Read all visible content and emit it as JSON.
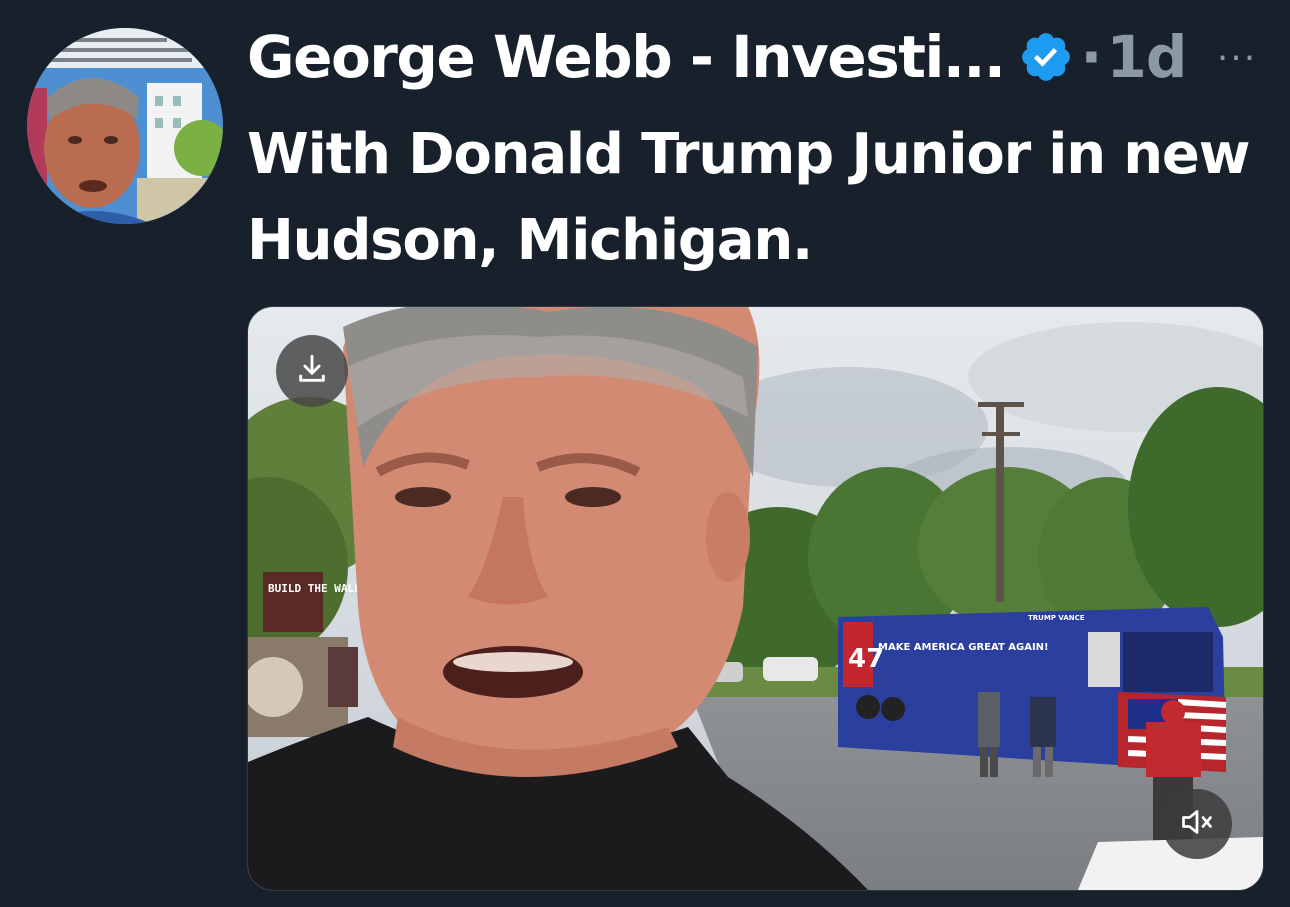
{
  "tweet": {
    "author_name": "George Webb - Investi...",
    "separator": "·",
    "timestamp": "1d",
    "more_label": "···",
    "text": "With Donald Trump Junior in new Hudson, Michigan."
  },
  "media": {
    "sign_text": "BUILD THE WALL",
    "bus_text": "MAKE AMERICA GREAT AGAIN!",
    "bus_number": "47",
    "bus_logo": "TRUMP VANCE"
  },
  "icons": {
    "verified": "verified-badge-icon",
    "more": "more-horizontal-icon",
    "download": "download-icon",
    "mute": "speaker-muted-icon"
  },
  "colors": {
    "background": "#17202b",
    "verified": "#1d9bf0",
    "muted_text": "#8b98a5"
  }
}
